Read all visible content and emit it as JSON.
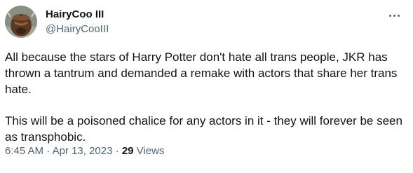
{
  "author": {
    "display_name": "HairyCoo III",
    "handle": "@HairyCooIII",
    "avatar_icon": "highland-cow-avatar"
  },
  "menu": {
    "icon": "more-icon"
  },
  "tweet": {
    "paragraphs": [
      "All because the stars of Harry Potter don't hate all trans people, JKR has thrown a tantrum and demanded a remake with actors that share her trans hate.",
      "This will be a poisoned chalice for any actors in it - they will forever be seen as transphobic."
    ]
  },
  "meta": {
    "time": "6:45 AM",
    "separator1": " · ",
    "date": "Apr 13, 2023",
    "separator2": " · ",
    "views_count": "29",
    "views_label": " Views"
  },
  "colors": {
    "text_primary": "#0f1419",
    "text_secondary": "#536471",
    "background": "#ffffff"
  }
}
